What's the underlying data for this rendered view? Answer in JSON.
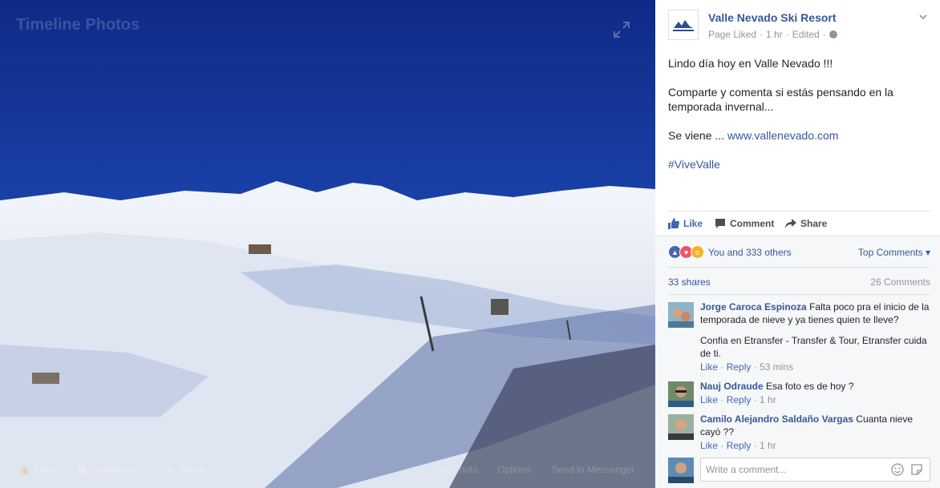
{
  "photo": {
    "title": "Timeline Photos",
    "actions": {
      "like": "Like",
      "comment": "Comment",
      "share": "Share",
      "tag": "Tag Photo",
      "options": "Options",
      "messenger": "Send in Messenger"
    }
  },
  "post": {
    "page_name": "Valle Nevado Ski Resort",
    "meta_liked": "Page Liked",
    "meta_time": "1 hr",
    "meta_edited": "Edited",
    "line1": "Lindo día hoy en Valle Nevado !!!",
    "line2": "Comparte y comenta si estás pensando en la temporada invernal...",
    "line3_prefix": "Se viene ... ",
    "line3_link": "www.vallenevado.com",
    "hashtag": "#ViveValle",
    "actions": {
      "like": "Like",
      "comment": "Comment",
      "share": "Share"
    }
  },
  "ufi": {
    "reactions_text": "You and 333 others",
    "top_comments": "Top Comments",
    "shares": "33 shares",
    "comments_count": "26 Comments"
  },
  "comments": [
    {
      "author": "Jorge Caroca Espinoza",
      "text": "Falta poco pra el inicio de la temporada de nieve y ya tienes quien te lleve?",
      "extra": "Confia en Etransfer - Transfer & Tour, Etransfer cuida de ti.",
      "like": "Like",
      "reply": "Reply",
      "time": "53 mins"
    },
    {
      "author": "Nauj Odraude",
      "text": "Esa foto es de hoy ?",
      "like": "Like",
      "reply": "Reply",
      "time": "1 hr"
    },
    {
      "author": "Camilo Alejandro Saldaño Vargas",
      "text": "Cuanta nieve cayó ??",
      "like": "Like",
      "reply": "Reply",
      "time": "1 hr"
    }
  ],
  "composer": {
    "placeholder": "Write a comment..."
  },
  "colors": {
    "link": "#365899",
    "like_blue": "#4267b2",
    "sky": "#1a3a9c"
  }
}
